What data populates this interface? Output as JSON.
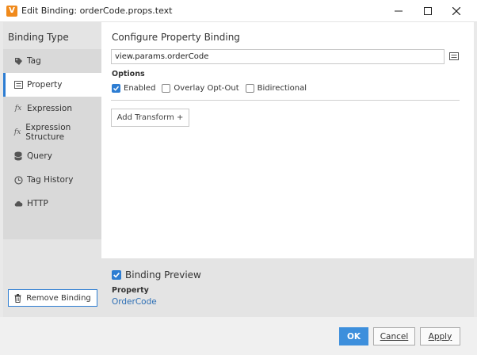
{
  "window": {
    "app_icon_glyph": "V",
    "title": "Edit Binding: orderCode.props.text"
  },
  "sidebar": {
    "heading": "Binding Type",
    "items": [
      {
        "label": "Tag",
        "icon": "tag-icon"
      },
      {
        "label": "Property",
        "icon": "property-icon",
        "active": true
      },
      {
        "label": "Expression",
        "icon": "fx-icon"
      },
      {
        "label": "Expression Structure",
        "icon": "fx-icon"
      },
      {
        "label": "Query",
        "icon": "database-icon"
      },
      {
        "label": "Tag History",
        "icon": "clock-icon"
      },
      {
        "label": "HTTP",
        "icon": "cloud-icon"
      }
    ],
    "remove_label": "Remove Binding"
  },
  "config": {
    "title": "Configure Property Binding",
    "property_value": "view.params.orderCode",
    "options_label": "Options",
    "enabled_label": "Enabled",
    "enabled_checked": true,
    "overlay_label": "Overlay Opt-Out",
    "overlay_checked": false,
    "bidirectional_label": "Bidirectional",
    "bidirectional_checked": false,
    "add_transform_label": "Add Transform +"
  },
  "preview": {
    "label": "Binding Preview",
    "checked": true,
    "property_label": "Property",
    "property_value": "OrderCode"
  },
  "footer": {
    "ok_label": "OK",
    "cancel_label": "Cancel",
    "apply_label": "Apply"
  },
  "colors": {
    "accent": "#2d7dd2",
    "ok_button": "#3d8fdc",
    "app_icon": "#f08a1c"
  }
}
